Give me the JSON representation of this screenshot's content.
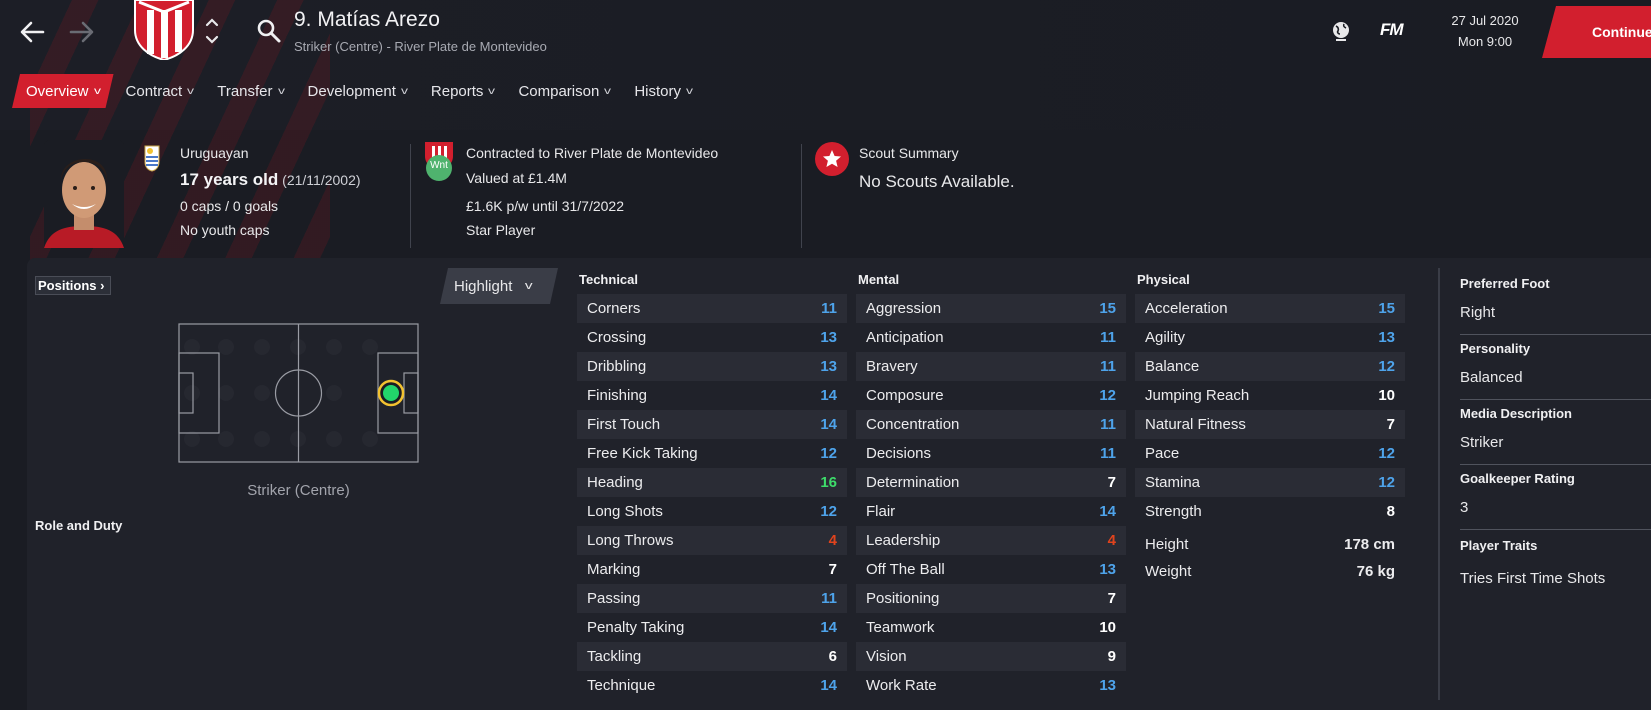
{
  "header": {
    "player_name": "9. Matías Arezo",
    "player_subtitle": "Striker (Centre) - River Plate de Montevideo",
    "date": "27 Jul 2020",
    "time": "Mon 9:00",
    "continue_label": "Continue",
    "fm_logo": "FM"
  },
  "tabs": [
    {
      "label": "Overview",
      "active": true
    },
    {
      "label": "Contract"
    },
    {
      "label": "Transfer"
    },
    {
      "label": "Development"
    },
    {
      "label": "Reports"
    },
    {
      "label": "Comparison"
    },
    {
      "label": "History"
    }
  ],
  "info": {
    "nationality": "Uruguayan",
    "age": "17 years old",
    "dob": "(21/11/2002)",
    "caps": "0 caps / 0 goals",
    "youth_caps": "No youth caps",
    "contract": "Contracted to River Plate de Montevideo",
    "value": "Valued at £1.4M",
    "wage": "£1.6K p/w until 31/7/2022",
    "status": "Star Player",
    "club_badge_text": "Wnt",
    "scout_title": "Scout Summary",
    "scout_text": "No Scouts Available."
  },
  "positions": {
    "button_label": "Positions",
    "highlight_label": "Highlight",
    "position_label": "Striker (Centre)",
    "role_duty_label": "Role and Duty"
  },
  "attributes": {
    "technical": {
      "title": "Technical",
      "items": [
        {
          "name": "Corners",
          "value": "11",
          "color": "#4ea3ea"
        },
        {
          "name": "Crossing",
          "value": "13",
          "color": "#4ea3ea"
        },
        {
          "name": "Dribbling",
          "value": "13",
          "color": "#4ea3ea"
        },
        {
          "name": "Finishing",
          "value": "14",
          "color": "#4ea3ea"
        },
        {
          "name": "First Touch",
          "value": "14",
          "color": "#4ea3ea"
        },
        {
          "name": "Free Kick Taking",
          "value": "12",
          "color": "#4ea3ea"
        },
        {
          "name": "Heading",
          "value": "16",
          "color": "#3ddc6a"
        },
        {
          "name": "Long Shots",
          "value": "12",
          "color": "#4ea3ea"
        },
        {
          "name": "Long Throws",
          "value": "4",
          "color": "#e0431d"
        },
        {
          "name": "Marking",
          "value": "7",
          "color": "#ffffff"
        },
        {
          "name": "Passing",
          "value": "11",
          "color": "#4ea3ea"
        },
        {
          "name": "Penalty Taking",
          "value": "14",
          "color": "#4ea3ea"
        },
        {
          "name": "Tackling",
          "value": "6",
          "color": "#ffffff"
        },
        {
          "name": "Technique",
          "value": "14",
          "color": "#4ea3ea"
        }
      ]
    },
    "mental": {
      "title": "Mental",
      "items": [
        {
          "name": "Aggression",
          "value": "15",
          "color": "#4ea3ea"
        },
        {
          "name": "Anticipation",
          "value": "11",
          "color": "#4ea3ea"
        },
        {
          "name": "Bravery",
          "value": "11",
          "color": "#4ea3ea"
        },
        {
          "name": "Composure",
          "value": "12",
          "color": "#4ea3ea"
        },
        {
          "name": "Concentration",
          "value": "11",
          "color": "#4ea3ea"
        },
        {
          "name": "Decisions",
          "value": "11",
          "color": "#4ea3ea"
        },
        {
          "name": "Determination",
          "value": "7",
          "color": "#ffffff"
        },
        {
          "name": "Flair",
          "value": "14",
          "color": "#4ea3ea"
        },
        {
          "name": "Leadership",
          "value": "4",
          "color": "#e0431d"
        },
        {
          "name": "Off The Ball",
          "value": "13",
          "color": "#4ea3ea"
        },
        {
          "name": "Positioning",
          "value": "7",
          "color": "#ffffff"
        },
        {
          "name": "Teamwork",
          "value": "10",
          "color": "#ffffff"
        },
        {
          "name": "Vision",
          "value": "9",
          "color": "#ffffff"
        },
        {
          "name": "Work Rate",
          "value": "13",
          "color": "#4ea3ea"
        }
      ]
    },
    "physical": {
      "title": "Physical",
      "items": [
        {
          "name": "Acceleration",
          "value": "15",
          "color": "#4ea3ea"
        },
        {
          "name": "Agility",
          "value": "13",
          "color": "#4ea3ea"
        },
        {
          "name": "Balance",
          "value": "12",
          "color": "#4ea3ea"
        },
        {
          "name": "Jumping Reach",
          "value": "10",
          "color": "#ffffff"
        },
        {
          "name": "Natural Fitness",
          "value": "7",
          "color": "#ffffff"
        },
        {
          "name": "Pace",
          "value": "12",
          "color": "#4ea3ea"
        },
        {
          "name": "Stamina",
          "value": "12",
          "color": "#4ea3ea"
        },
        {
          "name": "Strength",
          "value": "8",
          "color": "#ffffff"
        }
      ],
      "height_label": "Height",
      "height_value": "178 cm",
      "weight_label": "Weight",
      "weight_value": "76 kg"
    }
  },
  "side": {
    "foot_label": "Preferred Foot",
    "foot_value": "Right",
    "personality_label": "Personality",
    "personality_value": "Balanced",
    "media_label": "Media Description",
    "media_value": "Striker",
    "gk_label": "Goalkeeper Rating",
    "gk_value": "3",
    "traits_label": "Player Traits",
    "traits_value": "Tries First Time Shots"
  },
  "colors": {
    "accent": "#d21f2e",
    "good": "#4ea3ea",
    "excellent": "#3ddc6a",
    "poor": "#e0431d"
  }
}
